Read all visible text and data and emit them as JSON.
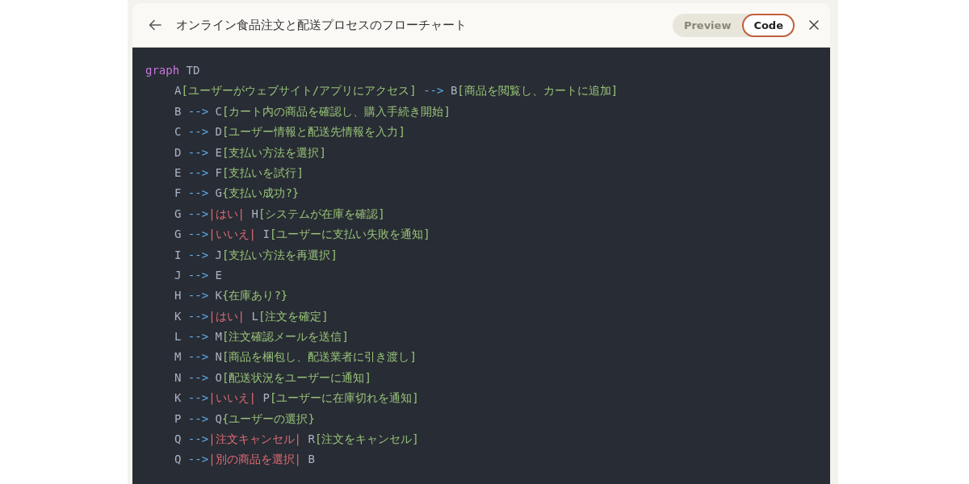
{
  "header": {
    "title": "オンライン食品注文と配送プロセスのフローチャート"
  },
  "view_toggle": [
    {
      "label": "Preview",
      "selected": false
    },
    {
      "label": "Code",
      "selected": true
    }
  ],
  "code": {
    "lines": [
      {
        "tokens": [
          {
            "kind": "keyword",
            "text": "graph"
          },
          {
            "kind": "plain",
            "text": " TD"
          }
        ]
      },
      {
        "tokens": [
          {
            "kind": "plain",
            "text": "A"
          },
          {
            "kind": "node",
            "text": "[ユーザーがウェブサイト/アプリにアクセス]"
          },
          {
            "kind": "arrow",
            "text": " -->"
          },
          {
            "kind": "plain",
            "text": " B"
          },
          {
            "kind": "node",
            "text": "[商品を閲覧し、カートに追加]"
          }
        ]
      },
      {
        "tokens": [
          {
            "kind": "plain",
            "text": "B "
          },
          {
            "kind": "arrow",
            "text": "-->"
          },
          {
            "kind": "plain",
            "text": " C"
          },
          {
            "kind": "node",
            "text": "[カート内の商品を確認し、購入手続き開始]"
          }
        ]
      },
      {
        "tokens": [
          {
            "kind": "plain",
            "text": "C "
          },
          {
            "kind": "arrow",
            "text": "-->"
          },
          {
            "kind": "plain",
            "text": " D"
          },
          {
            "kind": "node",
            "text": "[ユーザー情報と配送先情報を入力]"
          }
        ]
      },
      {
        "tokens": [
          {
            "kind": "plain",
            "text": "D "
          },
          {
            "kind": "arrow",
            "text": "-->"
          },
          {
            "kind": "plain",
            "text": " E"
          },
          {
            "kind": "node",
            "text": "[支払い方法を選択]"
          }
        ]
      },
      {
        "tokens": [
          {
            "kind": "plain",
            "text": "E "
          },
          {
            "kind": "arrow",
            "text": "-->"
          },
          {
            "kind": "plain",
            "text": " F"
          },
          {
            "kind": "node",
            "text": "[支払いを試行]"
          }
        ]
      },
      {
        "tokens": [
          {
            "kind": "plain",
            "text": "F "
          },
          {
            "kind": "arrow",
            "text": "-->"
          },
          {
            "kind": "plain",
            "text": " G"
          },
          {
            "kind": "node",
            "text": "{支払い成功?}"
          }
        ]
      },
      {
        "tokens": [
          {
            "kind": "plain",
            "text": "G "
          },
          {
            "kind": "arrow",
            "text": "-->"
          },
          {
            "kind": "label",
            "text": "|はい|"
          },
          {
            "kind": "plain",
            "text": " H"
          },
          {
            "kind": "node",
            "text": "[システムが在庫を確認]"
          }
        ]
      },
      {
        "tokens": [
          {
            "kind": "plain",
            "text": "G "
          },
          {
            "kind": "arrow",
            "text": "-->"
          },
          {
            "kind": "label",
            "text": "|いいえ|"
          },
          {
            "kind": "plain",
            "text": " I"
          },
          {
            "kind": "node",
            "text": "[ユーザーに支払い失敗を通知]"
          }
        ]
      },
      {
        "tokens": [
          {
            "kind": "plain",
            "text": "I "
          },
          {
            "kind": "arrow",
            "text": "-->"
          },
          {
            "kind": "plain",
            "text": " J"
          },
          {
            "kind": "node",
            "text": "[支払い方法を再選択]"
          }
        ]
      },
      {
        "tokens": [
          {
            "kind": "plain",
            "text": "J "
          },
          {
            "kind": "arrow",
            "text": "-->"
          },
          {
            "kind": "plain",
            "text": " E"
          }
        ]
      },
      {
        "tokens": [
          {
            "kind": "plain",
            "text": "H "
          },
          {
            "kind": "arrow",
            "text": "-->"
          },
          {
            "kind": "plain",
            "text": " K"
          },
          {
            "kind": "node",
            "text": "{在庫あり?}"
          }
        ]
      },
      {
        "tokens": [
          {
            "kind": "plain",
            "text": "K "
          },
          {
            "kind": "arrow",
            "text": "-->"
          },
          {
            "kind": "label",
            "text": "|はい|"
          },
          {
            "kind": "plain",
            "text": " L"
          },
          {
            "kind": "node",
            "text": "[注文を確定]"
          }
        ]
      },
      {
        "tokens": [
          {
            "kind": "plain",
            "text": "L "
          },
          {
            "kind": "arrow",
            "text": "-->"
          },
          {
            "kind": "plain",
            "text": " M"
          },
          {
            "kind": "node",
            "text": "[注文確認メールを送信]"
          }
        ]
      },
      {
        "tokens": [
          {
            "kind": "plain",
            "text": "M "
          },
          {
            "kind": "arrow",
            "text": "-->"
          },
          {
            "kind": "plain",
            "text": " N"
          },
          {
            "kind": "node",
            "text": "[商品を梱包し、配送業者に引き渡し]"
          }
        ]
      },
      {
        "tokens": [
          {
            "kind": "plain",
            "text": "N "
          },
          {
            "kind": "arrow",
            "text": "-->"
          },
          {
            "kind": "plain",
            "text": " O"
          },
          {
            "kind": "node",
            "text": "[配送状況をユーザーに通知]"
          }
        ]
      },
      {
        "tokens": [
          {
            "kind": "plain",
            "text": "K "
          },
          {
            "kind": "arrow",
            "text": "-->"
          },
          {
            "kind": "label",
            "text": "|いいえ|"
          },
          {
            "kind": "plain",
            "text": " P"
          },
          {
            "kind": "node",
            "text": "[ユーザーに在庫切れを通知]"
          }
        ]
      },
      {
        "tokens": [
          {
            "kind": "plain",
            "text": "P "
          },
          {
            "kind": "arrow",
            "text": "-->"
          },
          {
            "kind": "plain",
            "text": " Q"
          },
          {
            "kind": "node",
            "text": "{ユーザーの選択}"
          }
        ]
      },
      {
        "tokens": [
          {
            "kind": "plain",
            "text": "Q "
          },
          {
            "kind": "arrow",
            "text": "-->"
          },
          {
            "kind": "label",
            "text": "|注文キャンセル|"
          },
          {
            "kind": "plain",
            "text": " R"
          },
          {
            "kind": "node",
            "text": "[注文をキャンセル]"
          }
        ]
      },
      {
        "tokens": [
          {
            "kind": "plain",
            "text": "Q "
          },
          {
            "kind": "arrow",
            "text": "-->"
          },
          {
            "kind": "label",
            "text": "|別の商品を選択|"
          },
          {
            "kind": "plain",
            "text": " B"
          }
        ]
      }
    ]
  }
}
